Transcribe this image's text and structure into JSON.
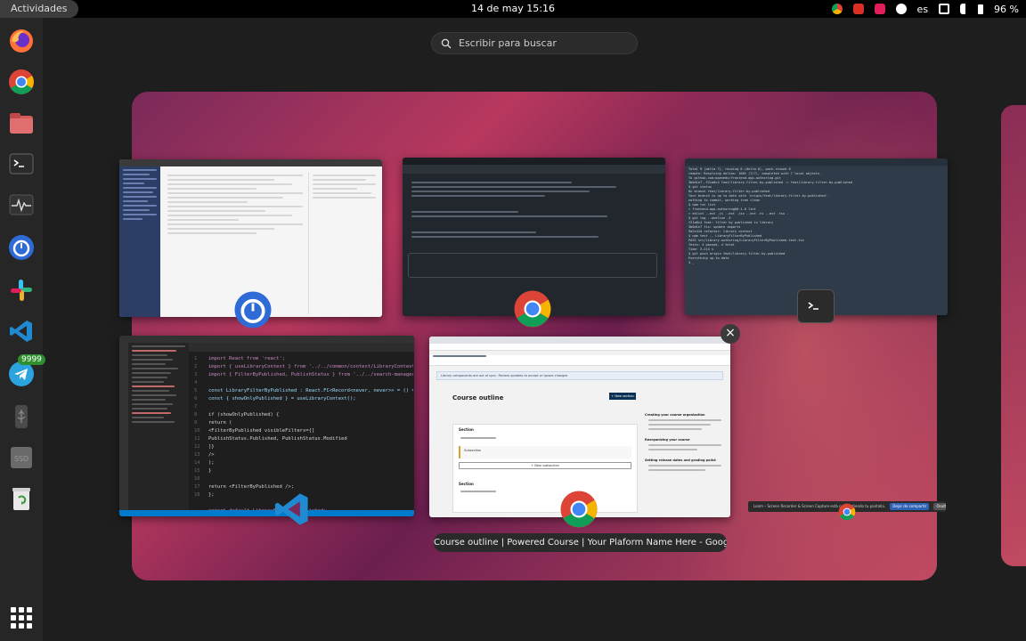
{
  "topbar": {
    "activities_label": "Actividades",
    "datetime": "14 de may  15:16",
    "language": "es",
    "battery": "96 %"
  },
  "search": {
    "placeholder": "Escribir para buscar"
  },
  "dock": {
    "telegram_badge": "9999",
    "items": [
      "firefox-icon",
      "chrome-icon",
      "files-icon",
      "terminal-icon",
      "system-monitor-icon",
      "timer-icon",
      "slack-icon",
      "vscode-icon",
      "telegram-icon",
      "usb-drive-icon",
      "ssd-drive-icon",
      "trash-icon"
    ]
  },
  "windows": {
    "browser_course": {
      "banner": "Library components are out of sync. Review updates to accept or ignore changes",
      "title": "Course outline",
      "new_section": "+ New section",
      "section_label": "Section",
      "subsection_label": "Subsection",
      "new_subsection": "+ New subsection",
      "sidebar_heading_1": "Creating your course organization",
      "sidebar_heading_2": "Reorganizing your course",
      "sidebar_heading_3": "Setting release dates and grading policies"
    },
    "vscode": {
      "code": [
        "import React from 'react';",
        "import { useLibraryContext } from '../../common/context/LibraryContext';",
        "import { FilterByPublished, PublishStatus } from '../../search-manager';",
        "",
        "const LibraryFilterByPublished : React.FC<Record<never, never>> = () => {",
        "  const { showOnlyPublished } = useLibraryContext();",
        "",
        "  if (showOnlyPublished) {",
        "    return (",
        "      <FilterByPublished visibleFilters={[",
        "        PublishStatus.Published, PublishStatus.Modified",
        "      ]}",
        "      />",
        "    );",
        "  }",
        "",
        "  return <FilterByPublished />;",
        "};",
        "",
        "export default LibraryFilterByPublished;"
      ]
    },
    "loom": {
      "text": "Loom – Screen Recorder & Screen Capture está compartiendo tu pantalla.",
      "stop_label": "Dejar de compartir",
      "hide_label": "Ocultar"
    }
  },
  "tooltip": "Course outline | Powered Course | Your Plaform Name Here - Googl..."
}
